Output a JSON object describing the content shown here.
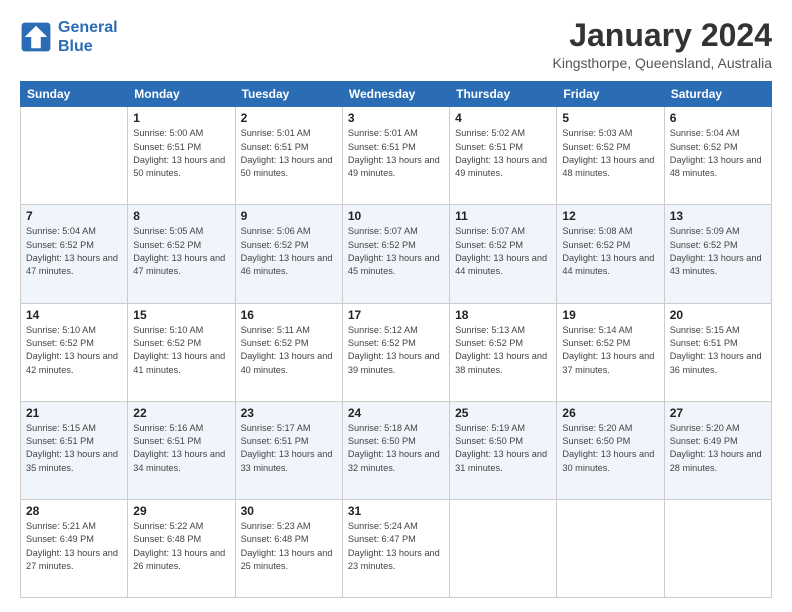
{
  "logo": {
    "line1": "General",
    "line2": "Blue"
  },
  "header": {
    "title": "January 2024",
    "location": "Kingsthorpe, Queensland, Australia"
  },
  "days_of_week": [
    "Sunday",
    "Monday",
    "Tuesday",
    "Wednesday",
    "Thursday",
    "Friday",
    "Saturday"
  ],
  "weeks": [
    [
      {
        "day": "",
        "info": ""
      },
      {
        "day": "1",
        "info": "Sunrise: 5:00 AM\nSunset: 6:51 PM\nDaylight: 13 hours\nand 50 minutes."
      },
      {
        "day": "2",
        "info": "Sunrise: 5:01 AM\nSunset: 6:51 PM\nDaylight: 13 hours\nand 50 minutes."
      },
      {
        "day": "3",
        "info": "Sunrise: 5:01 AM\nSunset: 6:51 PM\nDaylight: 13 hours\nand 49 minutes."
      },
      {
        "day": "4",
        "info": "Sunrise: 5:02 AM\nSunset: 6:51 PM\nDaylight: 13 hours\nand 49 minutes."
      },
      {
        "day": "5",
        "info": "Sunrise: 5:03 AM\nSunset: 6:52 PM\nDaylight: 13 hours\nand 48 minutes."
      },
      {
        "day": "6",
        "info": "Sunrise: 5:04 AM\nSunset: 6:52 PM\nDaylight: 13 hours\nand 48 minutes."
      }
    ],
    [
      {
        "day": "7",
        "info": "Sunrise: 5:04 AM\nSunset: 6:52 PM\nDaylight: 13 hours\nand 47 minutes."
      },
      {
        "day": "8",
        "info": "Sunrise: 5:05 AM\nSunset: 6:52 PM\nDaylight: 13 hours\nand 47 minutes."
      },
      {
        "day": "9",
        "info": "Sunrise: 5:06 AM\nSunset: 6:52 PM\nDaylight: 13 hours\nand 46 minutes."
      },
      {
        "day": "10",
        "info": "Sunrise: 5:07 AM\nSunset: 6:52 PM\nDaylight: 13 hours\nand 45 minutes."
      },
      {
        "day": "11",
        "info": "Sunrise: 5:07 AM\nSunset: 6:52 PM\nDaylight: 13 hours\nand 44 minutes."
      },
      {
        "day": "12",
        "info": "Sunrise: 5:08 AM\nSunset: 6:52 PM\nDaylight: 13 hours\nand 44 minutes."
      },
      {
        "day": "13",
        "info": "Sunrise: 5:09 AM\nSunset: 6:52 PM\nDaylight: 13 hours\nand 43 minutes."
      }
    ],
    [
      {
        "day": "14",
        "info": "Sunrise: 5:10 AM\nSunset: 6:52 PM\nDaylight: 13 hours\nand 42 minutes."
      },
      {
        "day": "15",
        "info": "Sunrise: 5:10 AM\nSunset: 6:52 PM\nDaylight: 13 hours\nand 41 minutes."
      },
      {
        "day": "16",
        "info": "Sunrise: 5:11 AM\nSunset: 6:52 PM\nDaylight: 13 hours\nand 40 minutes."
      },
      {
        "day": "17",
        "info": "Sunrise: 5:12 AM\nSunset: 6:52 PM\nDaylight: 13 hours\nand 39 minutes."
      },
      {
        "day": "18",
        "info": "Sunrise: 5:13 AM\nSunset: 6:52 PM\nDaylight: 13 hours\nand 38 minutes."
      },
      {
        "day": "19",
        "info": "Sunrise: 5:14 AM\nSunset: 6:52 PM\nDaylight: 13 hours\nand 37 minutes."
      },
      {
        "day": "20",
        "info": "Sunrise: 5:15 AM\nSunset: 6:51 PM\nDaylight: 13 hours\nand 36 minutes."
      }
    ],
    [
      {
        "day": "21",
        "info": "Sunrise: 5:15 AM\nSunset: 6:51 PM\nDaylight: 13 hours\nand 35 minutes."
      },
      {
        "day": "22",
        "info": "Sunrise: 5:16 AM\nSunset: 6:51 PM\nDaylight: 13 hours\nand 34 minutes."
      },
      {
        "day": "23",
        "info": "Sunrise: 5:17 AM\nSunset: 6:51 PM\nDaylight: 13 hours\nand 33 minutes."
      },
      {
        "day": "24",
        "info": "Sunrise: 5:18 AM\nSunset: 6:50 PM\nDaylight: 13 hours\nand 32 minutes."
      },
      {
        "day": "25",
        "info": "Sunrise: 5:19 AM\nSunset: 6:50 PM\nDaylight: 13 hours\nand 31 minutes."
      },
      {
        "day": "26",
        "info": "Sunrise: 5:20 AM\nSunset: 6:50 PM\nDaylight: 13 hours\nand 30 minutes."
      },
      {
        "day": "27",
        "info": "Sunrise: 5:20 AM\nSunset: 6:49 PM\nDaylight: 13 hours\nand 28 minutes."
      }
    ],
    [
      {
        "day": "28",
        "info": "Sunrise: 5:21 AM\nSunset: 6:49 PM\nDaylight: 13 hours\nand 27 minutes."
      },
      {
        "day": "29",
        "info": "Sunrise: 5:22 AM\nSunset: 6:48 PM\nDaylight: 13 hours\nand 26 minutes."
      },
      {
        "day": "30",
        "info": "Sunrise: 5:23 AM\nSunset: 6:48 PM\nDaylight: 13 hours\nand 25 minutes."
      },
      {
        "day": "31",
        "info": "Sunrise: 5:24 AM\nSunset: 6:47 PM\nDaylight: 13 hours\nand 23 minutes."
      },
      {
        "day": "",
        "info": ""
      },
      {
        "day": "",
        "info": ""
      },
      {
        "day": "",
        "info": ""
      }
    ]
  ]
}
